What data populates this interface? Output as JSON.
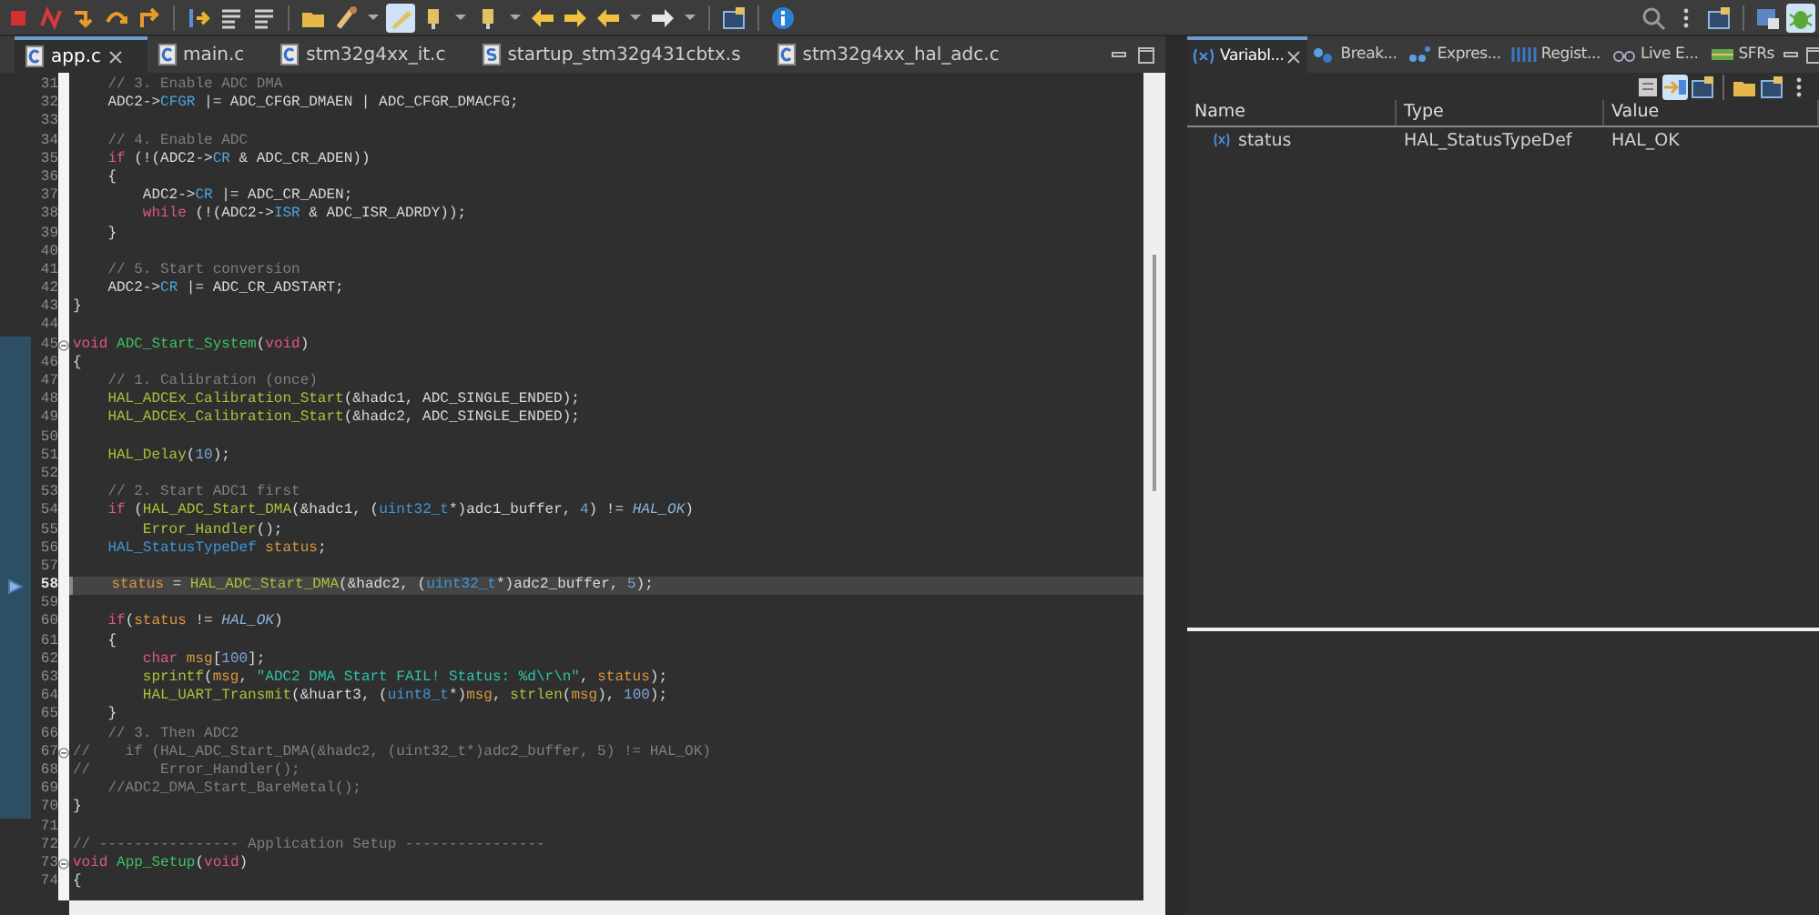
{
  "toolbar": {
    "left": [
      {
        "kind": "stop",
        "selected": false
      },
      {
        "kind": "disconnect",
        "selected": false
      },
      {
        "kind": "step-into",
        "selected": false
      },
      {
        "kind": "step-over",
        "selected": false
      },
      {
        "kind": "step-return",
        "selected": false
      },
      {
        "kind": "separator"
      },
      {
        "kind": "instr-step",
        "selected": false
      },
      {
        "kind": "list",
        "selected": false
      },
      {
        "kind": "list",
        "selected": false
      },
      {
        "kind": "separator"
      },
      {
        "kind": "folder",
        "selected": false
      },
      {
        "kind": "brush",
        "selected": false
      },
      {
        "kind": "caret",
        "selected": false
      },
      {
        "kind": "pen",
        "selected": true
      },
      {
        "kind": "pin",
        "selected": false
      },
      {
        "kind": "caret",
        "selected": false
      },
      {
        "kind": "pin",
        "selected": false
      },
      {
        "kind": "caret",
        "selected": false
      },
      {
        "kind": "back",
        "selected": false
      },
      {
        "kind": "forward",
        "selected": false
      },
      {
        "kind": "back",
        "selected": false
      },
      {
        "kind": "caret",
        "selected": false
      },
      {
        "kind": "forward-white",
        "selected": false
      },
      {
        "kind": "caret",
        "selected": false
      },
      {
        "kind": "separator"
      },
      {
        "kind": "window",
        "selected": false
      },
      {
        "kind": "separator"
      },
      {
        "kind": "info",
        "selected": false
      }
    ],
    "right": [
      {
        "kind": "search",
        "selected": false
      },
      {
        "kind": "more",
        "selected": false
      },
      {
        "kind": "window",
        "selected": false
      },
      {
        "kind": "separator"
      },
      {
        "kind": "perspective",
        "selected": false
      },
      {
        "kind": "debug",
        "selected": true
      }
    ]
  },
  "editor": {
    "tabs": [
      {
        "label": "app.c",
        "kind": "c",
        "selected": true,
        "closable": true
      },
      {
        "label": "main.c",
        "kind": "c",
        "selected": false,
        "closable": false
      },
      {
        "label": "stm32g4xx_it.c",
        "kind": "c",
        "selected": false,
        "closable": false
      },
      {
        "label": "startup_stm32g431cbtx.s",
        "kind": "asm",
        "selected": false,
        "closable": false
      },
      {
        "label": "stm32g4xx_hal_adc.c",
        "kind": "c",
        "selected": false,
        "closable": false
      }
    ],
    "lines": [
      {
        "number": "31",
        "scope": false,
        "fold": false,
        "current": false,
        "tokens": [
          {
            "kind": "comment",
            "text": "    // 3. Enable ADC DMA"
          }
        ]
      },
      {
        "number": "32",
        "scope": false,
        "fold": false,
        "current": false,
        "tokens": [
          {
            "kind": "plain",
            "text": "    ADC2->"
          },
          {
            "kind": "field",
            "text": "CFGR"
          },
          {
            "kind": "plain",
            "text": " |= ADC_CFGR_DMAEN | ADC_CFGR_DMACFG;"
          }
        ]
      },
      {
        "number": "33",
        "scope": false,
        "fold": false,
        "current": false
      },
      {
        "number": "34",
        "scope": false,
        "fold": false,
        "current": false,
        "tokens": [
          {
            "kind": "comment",
            "text": "    // 4. Enable ADC"
          }
        ]
      },
      {
        "number": "35",
        "scope": false,
        "fold": false,
        "current": false,
        "tokens": [
          {
            "kind": "keyword",
            "text": "    if"
          },
          {
            "kind": "plain",
            "text": " (!(ADC2->"
          },
          {
            "kind": "field",
            "text": "CR"
          },
          {
            "kind": "plain",
            "text": " & ADC_CR_ADEN))"
          }
        ]
      },
      {
        "number": "36",
        "scope": false,
        "fold": false,
        "current": false,
        "tokens": [
          {
            "kind": "plain",
            "text": "    {"
          }
        ]
      },
      {
        "number": "37",
        "scope": false,
        "fold": false,
        "current": false,
        "tokens": [
          {
            "kind": "plain",
            "text": "        ADC2->"
          },
          {
            "kind": "field",
            "text": "CR"
          },
          {
            "kind": "plain",
            "text": " |= ADC_CR_ADEN;"
          }
        ]
      },
      {
        "number": "38",
        "scope": false,
        "fold": false,
        "current": false,
        "tokens": [
          {
            "kind": "keyword",
            "text": "        while"
          },
          {
            "kind": "plain",
            "text": " (!(ADC2->"
          },
          {
            "kind": "field",
            "text": "ISR"
          },
          {
            "kind": "plain",
            "text": " & ADC_ISR_ADRDY));"
          }
        ]
      },
      {
        "number": "39",
        "scope": false,
        "fold": false,
        "current": false,
        "tokens": [
          {
            "kind": "plain",
            "text": "    }"
          }
        ]
      },
      {
        "number": "40",
        "scope": false,
        "fold": false,
        "current": false
      },
      {
        "number": "41",
        "scope": false,
        "fold": false,
        "current": false,
        "tokens": [
          {
            "kind": "comment",
            "text": "    // 5. Start conversion"
          }
        ]
      },
      {
        "number": "42",
        "scope": false,
        "fold": false,
        "current": false,
        "tokens": [
          {
            "kind": "plain",
            "text": "    ADC2->"
          },
          {
            "kind": "field",
            "text": "CR"
          },
          {
            "kind": "plain",
            "text": " |= ADC_CR_ADSTART;"
          }
        ]
      },
      {
        "number": "43",
        "scope": false,
        "fold": false,
        "current": false,
        "tokens": [
          {
            "kind": "plain",
            "text": "}"
          }
        ]
      },
      {
        "number": "44",
        "scope": false,
        "fold": false,
        "current": false
      },
      {
        "number": "45",
        "scope": true,
        "fold": true,
        "current": false,
        "tokens": [
          {
            "kind": "keyword",
            "text": "void "
          },
          {
            "kind": "decl",
            "text": "ADC_Start_System"
          },
          {
            "kind": "plain",
            "text": "("
          },
          {
            "kind": "keyword",
            "text": "void"
          },
          {
            "kind": "plain",
            "text": ")"
          }
        ]
      },
      {
        "number": "46",
        "scope": true,
        "fold": false,
        "current": false,
        "tokens": [
          {
            "kind": "plain",
            "text": "{"
          }
        ]
      },
      {
        "number": "47",
        "scope": true,
        "fold": false,
        "current": false,
        "tokens": [
          {
            "kind": "comment",
            "text": "    // 1. Calibration (once)"
          }
        ]
      },
      {
        "number": "48",
        "scope": true,
        "fold": false,
        "current": false,
        "tokens": [
          {
            "kind": "call",
            "text": "    HAL_ADCEx_Calibration_Start"
          },
          {
            "kind": "plain",
            "text": "(&hadc1, ADC_SINGLE_ENDED);"
          }
        ]
      },
      {
        "number": "49",
        "scope": true,
        "fold": false,
        "current": false,
        "tokens": [
          {
            "kind": "call",
            "text": "    HAL_ADCEx_Calibration_Start"
          },
          {
            "kind": "plain",
            "text": "(&hadc2, ADC_SINGLE_ENDED);"
          }
        ]
      },
      {
        "number": "50",
        "scope": true,
        "fold": false,
        "current": false
      },
      {
        "number": "51",
        "scope": true,
        "fold": false,
        "current": false,
        "tokens": [
          {
            "kind": "call",
            "text": "    HAL_Delay"
          },
          {
            "kind": "plain",
            "text": "("
          },
          {
            "kind": "number",
            "text": "10"
          },
          {
            "kind": "plain",
            "text": ");"
          }
        ]
      },
      {
        "number": "52",
        "scope": true,
        "fold": false,
        "current": false
      },
      {
        "number": "53",
        "scope": true,
        "fold": false,
        "current": false,
        "tokens": [
          {
            "kind": "comment",
            "text": "    // 2. Start ADC1 first"
          }
        ]
      },
      {
        "number": "54",
        "scope": true,
        "fold": false,
        "current": false,
        "tokens": [
          {
            "kind": "keyword",
            "text": "    if"
          },
          {
            "kind": "plain",
            "text": " ("
          },
          {
            "kind": "call",
            "text": "HAL_ADC_Start_DMA"
          },
          {
            "kind": "plain",
            "text": "(&hadc1, ("
          },
          {
            "kind": "type",
            "text": "uint32_t"
          },
          {
            "kind": "plain",
            "text": "*)adc1_buffer, "
          },
          {
            "kind": "number",
            "text": "4"
          },
          {
            "kind": "plain",
            "text": ") != "
          },
          {
            "kind": "constant",
            "text": "HAL_OK"
          },
          {
            "kind": "plain",
            "text": ")"
          }
        ]
      },
      {
        "number": "55",
        "scope": true,
        "fold": false,
        "current": false,
        "tokens": [
          {
            "kind": "call",
            "text": "        Error_Handler"
          },
          {
            "kind": "plain",
            "text": "();"
          }
        ]
      },
      {
        "number": "56",
        "scope": true,
        "fold": false,
        "current": false,
        "tokens": [
          {
            "kind": "type",
            "text": "    HAL_StatusTypeDef "
          },
          {
            "kind": "local",
            "text": "status"
          },
          {
            "kind": "plain",
            "text": ";"
          }
        ]
      },
      {
        "number": "57",
        "scope": true,
        "fold": false,
        "current": false
      },
      {
        "number": "58",
        "scope": true,
        "fold": false,
        "current": true,
        "tokens": [
          {
            "kind": "local",
            "text": "    status"
          },
          {
            "kind": "plain",
            "text": " = "
          },
          {
            "kind": "call",
            "text": "HAL_ADC_Start_DMA"
          },
          {
            "kind": "plain",
            "text": "(&hadc2, ("
          },
          {
            "kind": "type",
            "text": "uint32_t"
          },
          {
            "kind": "plain",
            "text": "*)adc2_buffer, "
          },
          {
            "kind": "number",
            "text": "5"
          },
          {
            "kind": "plain",
            "text": ");"
          }
        ]
      },
      {
        "number": "59",
        "scope": true,
        "fold": false,
        "current": false
      },
      {
        "number": "60",
        "scope": true,
        "fold": false,
        "current": false,
        "tokens": [
          {
            "kind": "keyword",
            "text": "    if"
          },
          {
            "kind": "plain",
            "text": "("
          },
          {
            "kind": "local",
            "text": "status"
          },
          {
            "kind": "plain",
            "text": " != "
          },
          {
            "kind": "constant",
            "text": "HAL_OK"
          },
          {
            "kind": "plain",
            "text": ")"
          }
        ]
      },
      {
        "number": "61",
        "scope": true,
        "fold": false,
        "current": false,
        "tokens": [
          {
            "kind": "plain",
            "text": "    {"
          }
        ]
      },
      {
        "number": "62",
        "scope": true,
        "fold": false,
        "current": false,
        "tokens": [
          {
            "kind": "keyword",
            "text": "        char "
          },
          {
            "kind": "local",
            "text": "msg"
          },
          {
            "kind": "plain",
            "text": "["
          },
          {
            "kind": "number",
            "text": "100"
          },
          {
            "kind": "plain",
            "text": "];"
          }
        ]
      },
      {
        "number": "63",
        "scope": true,
        "fold": false,
        "current": false,
        "tokens": [
          {
            "kind": "call",
            "text": "        sprintf"
          },
          {
            "kind": "plain",
            "text": "("
          },
          {
            "kind": "local",
            "text": "msg"
          },
          {
            "kind": "plain",
            "text": ", "
          },
          {
            "kind": "string",
            "text": "\"ADC2 DMA Start FAIL! Status: %d\\r\\n\""
          },
          {
            "kind": "plain",
            "text": ", "
          },
          {
            "kind": "local",
            "text": "status"
          },
          {
            "kind": "plain",
            "text": ");"
          }
        ]
      },
      {
        "number": "64",
        "scope": true,
        "fold": false,
        "current": false,
        "tokens": [
          {
            "kind": "call",
            "text": "        HAL_UART_Transmit"
          },
          {
            "kind": "plain",
            "text": "(&huart3, ("
          },
          {
            "kind": "type",
            "text": "uint8_t"
          },
          {
            "kind": "plain",
            "text": "*)"
          },
          {
            "kind": "local",
            "text": "msg"
          },
          {
            "kind": "plain",
            "text": ", "
          },
          {
            "kind": "call",
            "text": "strlen"
          },
          {
            "kind": "plain",
            "text": "("
          },
          {
            "kind": "local",
            "text": "msg"
          },
          {
            "kind": "plain",
            "text": "), "
          },
          {
            "kind": "number",
            "text": "100"
          },
          {
            "kind": "plain",
            "text": ");"
          }
        ]
      },
      {
        "number": "65",
        "scope": true,
        "fold": false,
        "current": false,
        "tokens": [
          {
            "kind": "plain",
            "text": "    }"
          }
        ]
      },
      {
        "number": "66",
        "scope": true,
        "fold": false,
        "current": false,
        "tokens": [
          {
            "kind": "comment",
            "text": "    // 3. Then ADC2"
          }
        ]
      },
      {
        "number": "67",
        "scope": true,
        "fold": true,
        "current": false,
        "tokens": [
          {
            "kind": "comment",
            "text": "//    if (HAL_ADC_Start_DMA(&hadc2, (uint32_t*)adc2_buffer, 5) != HAL_OK)"
          }
        ]
      },
      {
        "number": "68",
        "scope": true,
        "fold": false,
        "current": false,
        "tokens": [
          {
            "kind": "comment",
            "text": "//        Error_Handler();"
          }
        ]
      },
      {
        "number": "69",
        "scope": true,
        "fold": false,
        "current": false,
        "tokens": [
          {
            "kind": "comment",
            "text": "    //ADC2_DMA_Start_BareMetal();"
          }
        ]
      },
      {
        "number": "70",
        "scope": true,
        "fold": false,
        "current": false,
        "tokens": [
          {
            "kind": "plain",
            "text": "}"
          }
        ]
      },
      {
        "number": "71",
        "scope": false,
        "fold": false,
        "current": false
      },
      {
        "number": "72",
        "scope": false,
        "fold": false,
        "current": false,
        "tokens": [
          {
            "kind": "comment",
            "text": "// ---------------- Application Setup ----------------"
          }
        ]
      },
      {
        "number": "73",
        "scope": false,
        "fold": true,
        "current": false,
        "tokens": [
          {
            "kind": "keyword",
            "text": "void "
          },
          {
            "kind": "decl",
            "text": "App_Setup"
          },
          {
            "kind": "plain",
            "text": "("
          },
          {
            "kind": "keyword",
            "text": "void"
          },
          {
            "kind": "plain",
            "text": ")"
          }
        ]
      },
      {
        "number": "74",
        "scope": false,
        "fold": false,
        "current": false,
        "tokens": [
          {
            "kind": "plain",
            "text": "{"
          }
        ]
      }
    ]
  },
  "views": {
    "tabs": [
      {
        "label": "Variabl...",
        "kind": "variables",
        "selected": true,
        "closable": true
      },
      {
        "label": "Break...",
        "kind": "breakpoints",
        "selected": false,
        "closable": false
      },
      {
        "label": "Expres...",
        "kind": "expressions",
        "selected": false,
        "closable": false
      },
      {
        "label": "Regist...",
        "kind": "registers",
        "selected": false,
        "closable": false
      },
      {
        "label": "Live E...",
        "kind": "live",
        "selected": false,
        "closable": false
      },
      {
        "label": "SFRs",
        "kind": "sfrs",
        "selected": false,
        "closable": false
      }
    ],
    "tools": [
      {
        "kind": "doc",
        "selected": false
      },
      {
        "kind": "arrows",
        "selected": true
      },
      {
        "kind": "window",
        "selected": false
      },
      {
        "kind": "separator"
      },
      {
        "kind": "folder",
        "selected": false
      },
      {
        "kind": "window",
        "selected": false
      },
      {
        "kind": "more",
        "selected": false
      }
    ],
    "table": {
      "columns": [
        "Name",
        "Type",
        "Value"
      ],
      "rows": [
        {
          "name": "status",
          "type": "HAL_StatusTypeDef",
          "value": "HAL_OK"
        }
      ]
    }
  }
}
